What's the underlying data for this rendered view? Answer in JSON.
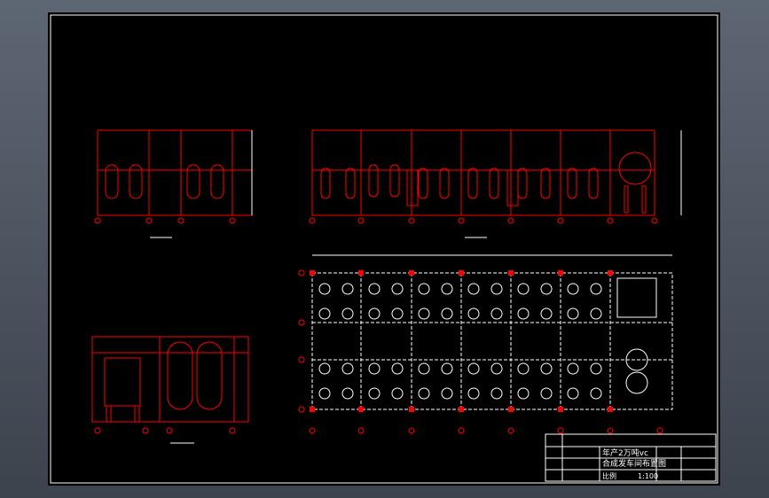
{
  "title_block": {
    "line1": "年产2万吨vc",
    "line2": "合成发车间布置图",
    "scale_label": "比例",
    "scale_value": "1:100"
  },
  "colors": {
    "background": "#000000",
    "equipment": "#ff0000",
    "annotation": "#ffffff",
    "frame_outer": "#5d6673"
  }
}
